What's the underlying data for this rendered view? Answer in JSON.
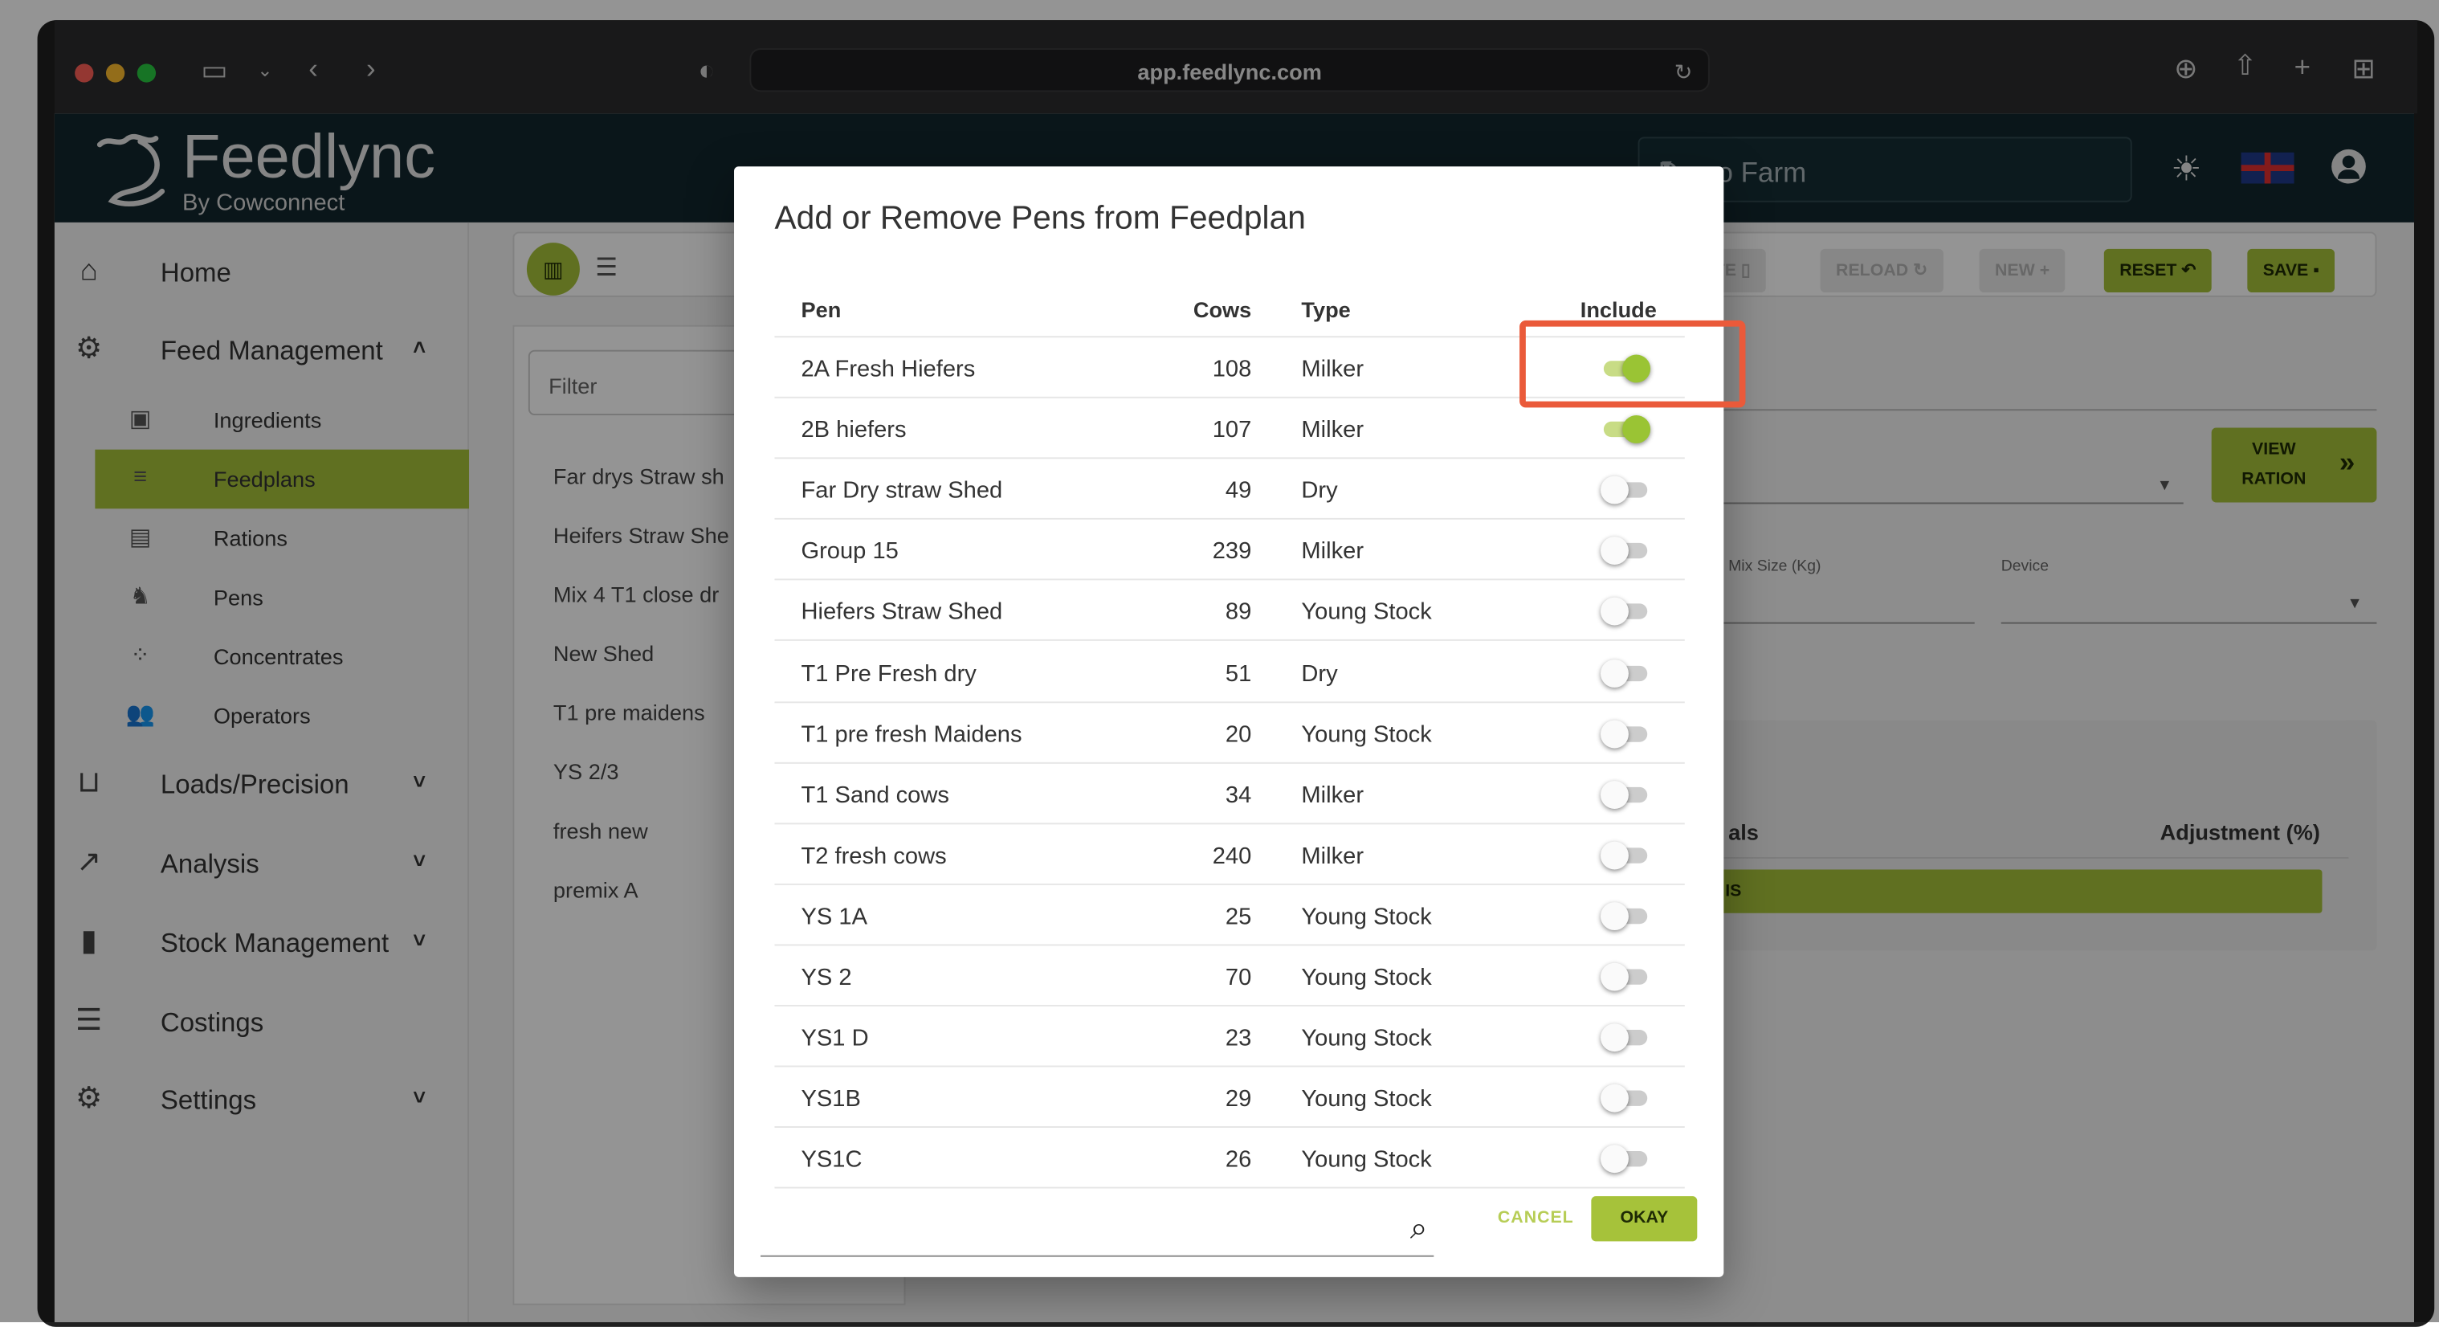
{
  "browser": {
    "url": "app.feedlync.com"
  },
  "app": {
    "logo_name": "Feedlync",
    "logo_tagline": "By Cowconnect",
    "farm_select_value": "Demo Farm"
  },
  "sidebar": {
    "home": "Home",
    "feed_management": "Feed Management",
    "sub_items": [
      {
        "label": "Ingredients",
        "icon": "ingredients-icon"
      },
      {
        "label": "Feedplans",
        "icon": "feedplans-icon"
      },
      {
        "label": "Rations",
        "icon": "rations-icon"
      },
      {
        "label": "Pens",
        "icon": "pens-icon"
      },
      {
        "label": "Concentrates",
        "icon": "concentrates-icon"
      },
      {
        "label": "Operators",
        "icon": "operators-icon"
      }
    ],
    "loads_precision": "Loads/Precision",
    "analysis": "Analysis",
    "stock_management": "Stock Management",
    "costings": "Costings",
    "settings": "Settings"
  },
  "toolbar": {
    "delete": "TE",
    "reload": "RELOAD",
    "new": "NEW",
    "reset": "RESET",
    "save": "SAVE"
  },
  "list": {
    "filter_label": "Filter",
    "items": [
      "Far drys Straw sh",
      "Heifers Straw She",
      "Mix 4 T1 close dr",
      "New Shed",
      "T1 pre maidens",
      "YS 2/3",
      "fresh new",
      "premix A"
    ]
  },
  "right_panel": {
    "view_ration_line1": "VIEW",
    "view_ration_line2": "RATION",
    "mix_size_label": "Mix Size (Kg)",
    "device_label": "Device",
    "totals_partial": "als",
    "adjustment_header": "Adjustment (%)",
    "bar_partial": "IS"
  },
  "modal": {
    "title": "Add or Remove Pens from Feedplan",
    "columns": {
      "pen": "Pen",
      "cows": "Cows",
      "type": "Type",
      "include": "Include"
    },
    "rows": [
      {
        "pen": "2A Fresh Hiefers",
        "cows": "108",
        "type": "Milker",
        "include": true
      },
      {
        "pen": "2B hiefers",
        "cows": "107",
        "type": "Milker",
        "include": true
      },
      {
        "pen": "Far Dry straw Shed",
        "cows": "49",
        "type": "Dry",
        "include": false
      },
      {
        "pen": "Group 15",
        "cows": "239",
        "type": "Milker",
        "include": false
      },
      {
        "pen": "Hiefers Straw Shed",
        "cows": "89",
        "type": "Young Stock",
        "include": false
      },
      {
        "pen": "T1 Pre Fresh dry",
        "cows": "51",
        "type": "Dry",
        "include": false
      },
      {
        "pen": "T1 pre fresh Maidens",
        "cows": "20",
        "type": "Young Stock",
        "include": false
      },
      {
        "pen": "T1 Sand cows",
        "cows": "34",
        "type": "Milker",
        "include": false
      },
      {
        "pen": "T2 fresh cows",
        "cows": "240",
        "type": "Milker",
        "include": false
      },
      {
        "pen": "YS 1A",
        "cows": "25",
        "type": "Young Stock",
        "include": false
      },
      {
        "pen": "YS 2",
        "cows": "70",
        "type": "Young Stock",
        "include": false
      },
      {
        "pen": "YS1 D",
        "cows": "23",
        "type": "Young Stock",
        "include": false
      },
      {
        "pen": "YS1B",
        "cows": "29",
        "type": "Young Stock",
        "include": false
      },
      {
        "pen": "YS1C",
        "cows": "26",
        "type": "Young Stock",
        "include": false
      }
    ],
    "cancel": "CANCEL",
    "okay": "OKAY"
  },
  "colors": {
    "accent": "#a6c23a",
    "topbar": "#12262d",
    "highlight": "#ea5a3a"
  }
}
